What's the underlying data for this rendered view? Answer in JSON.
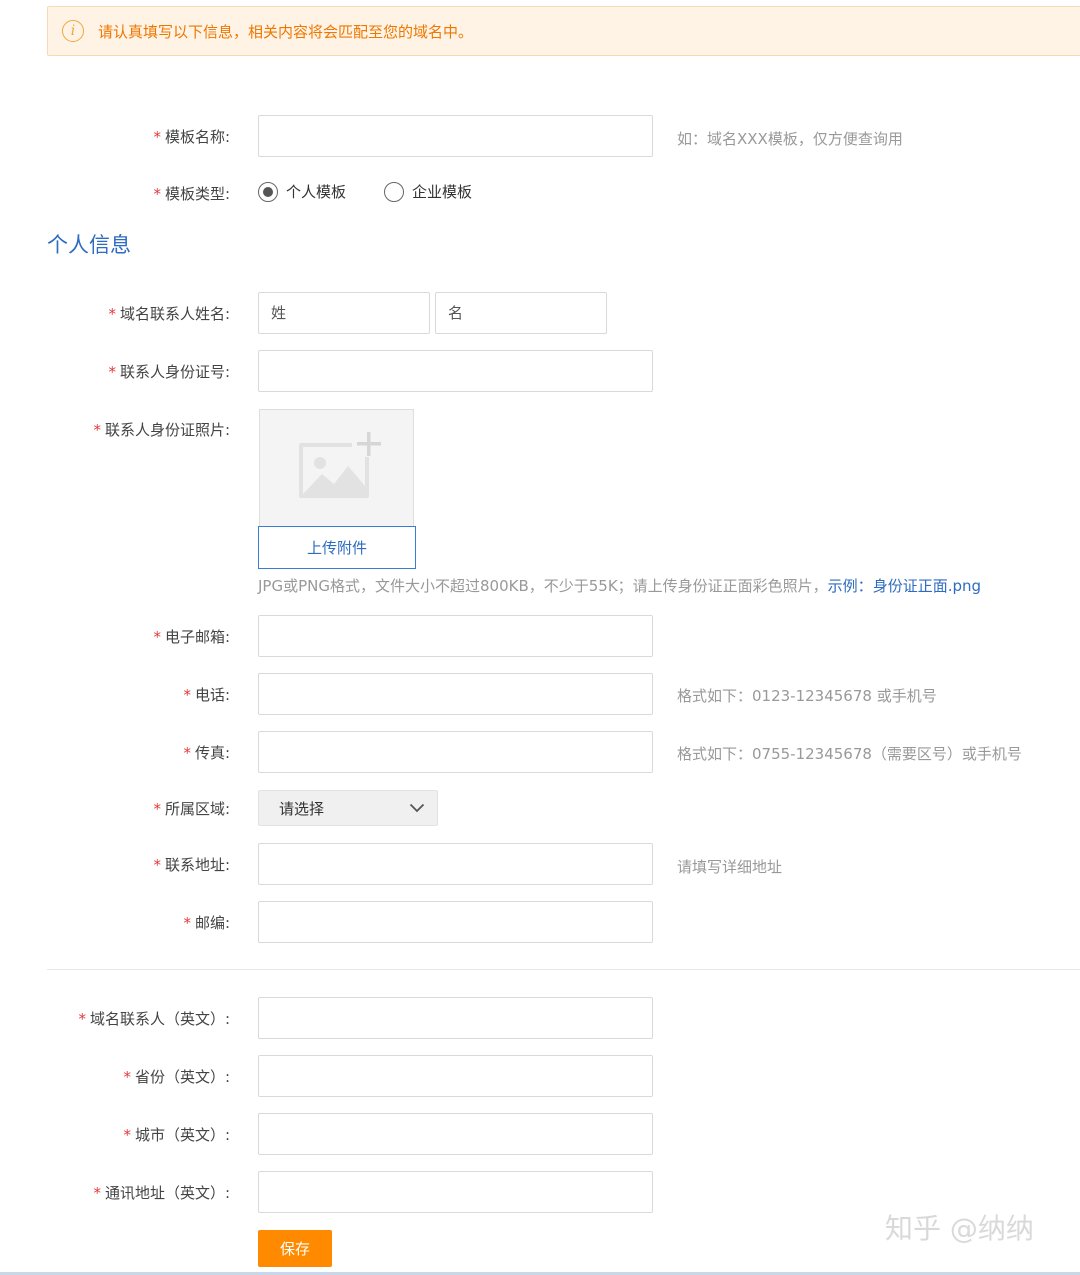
{
  "notice": {
    "icon": "info-icon",
    "text": "请认真填写以下信息，相关内容将会匹配至您的域名中。"
  },
  "form": {
    "template_name": {
      "label": "模板名称:",
      "value": "",
      "hint": "如：域名XXX模板，仅方便查询用"
    },
    "template_type": {
      "label": "模板类型:",
      "options": [
        {
          "label": "个人模板",
          "checked": true
        },
        {
          "label": "企业模板",
          "checked": false
        }
      ]
    }
  },
  "section": {
    "title": "个人信息"
  },
  "personal": {
    "contact_name": {
      "label": "域名联系人姓名:",
      "surname_placeholder": "姓",
      "given_placeholder": "名"
    },
    "id_number": {
      "label": "联系人身份证号:",
      "value": ""
    },
    "id_photo": {
      "label": "联系人身份证照片:",
      "upload_icon": "image-add-icon",
      "upload_button": "上传附件",
      "hint": "JPG或PNG格式，文件大小不超过800KB，不少于55K；请上传身份证正面彩色照片，",
      "example_label": "示例：",
      "example_link": "身份证正面.png"
    },
    "email": {
      "label": "电子邮箱:",
      "value": ""
    },
    "phone": {
      "label": "电话:",
      "value": "",
      "hint": "格式如下：0123-12345678 或手机号"
    },
    "fax": {
      "label": "传真:",
      "value": "",
      "hint": "格式如下：0755-12345678（需要区号）或手机号"
    },
    "region": {
      "label": "所属区域:",
      "selected": "请选择"
    },
    "address": {
      "label": "联系地址:",
      "value": "",
      "hint": "请填写详细地址"
    },
    "postcode": {
      "label": "邮编:",
      "value": ""
    }
  },
  "english": {
    "contact": {
      "label": "域名联系人（英文）:",
      "value": ""
    },
    "province": {
      "label": "省份（英文）:",
      "value": ""
    },
    "city": {
      "label": "城市（英文）:",
      "value": ""
    },
    "address": {
      "label": "通讯地址（英文）:",
      "value": ""
    }
  },
  "actions": {
    "save_label": "保存"
  },
  "watermark": "知乎 @纳纳",
  "colors": {
    "accent_blue": "#2d6cc0",
    "orange": "#ff8a00",
    "required": "#e4393c",
    "notice_text": "#ee7700"
  }
}
